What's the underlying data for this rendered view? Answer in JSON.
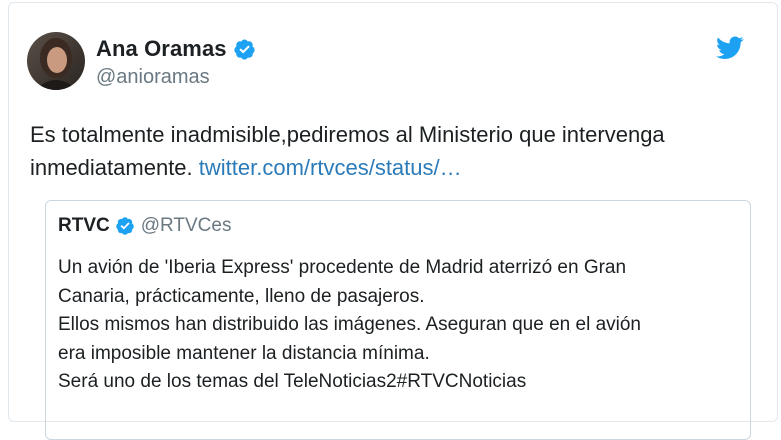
{
  "author": {
    "display_name": "Ana Oramas",
    "handle": "@anioramas",
    "verified": true,
    "avatar_icon": "user-avatar"
  },
  "tweet": {
    "text": "Es totalmente inadmisible,pediremos al Ministerio que intervenga inmediatamente.",
    "link": "twitter.com/rtvces/status/…"
  },
  "quoted_tweet": {
    "display_name": "RTVC",
    "handle": "@RTVCes",
    "verified": true,
    "lines": [
      "Un avión de 'Iberia Express' procedente de Madrid aterrizó  en Gran",
      "Canaria, prácticamente, lleno de pasajeros.",
      "Ellos mismos han distribuido las imágenes. Aseguran que en el avión",
      "era imposible mantener la distancia mínima.",
      "Será uno de los temas del TeleNoticias2#RTVCNoticias"
    ]
  },
  "icons": {
    "brand": "twitter-bird-icon",
    "verified": "verified-badge-icon"
  },
  "colors": {
    "link": "#2b7bb9",
    "verified": "#1da1f2",
    "brand": "#1da1f2",
    "secondary_text": "#697882",
    "border": "#ccd6dd"
  }
}
